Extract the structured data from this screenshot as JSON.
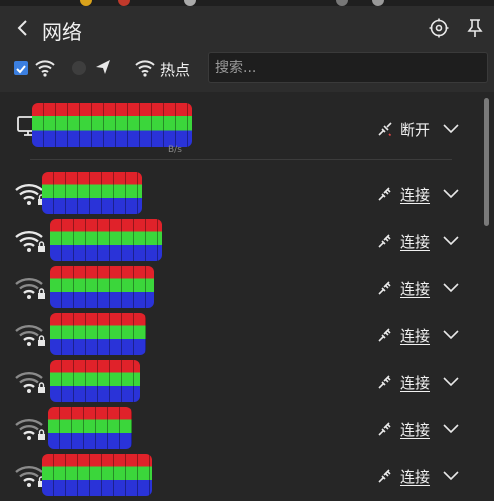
{
  "header": {
    "title": "网络",
    "back_icon": "back-arrow-icon",
    "settings_icon": "settings-icon",
    "pin_icon": "pin-icon"
  },
  "toolbar": {
    "wifi_enabled": true,
    "hotspot_label": "热点",
    "search_placeholder": "搜索..."
  },
  "connected": {
    "speed_suffix": "B/s",
    "action_label": "断开"
  },
  "networks": [
    {
      "action_label": "连接",
      "signal": "full"
    },
    {
      "action_label": "连接",
      "signal": "full"
    },
    {
      "action_label": "连接",
      "signal": "medium"
    },
    {
      "action_label": "连接",
      "signal": "medium"
    },
    {
      "action_label": "连接",
      "signal": "medium"
    },
    {
      "action_label": "连接",
      "signal": "medium"
    },
    {
      "action_label": "连接",
      "signal": "medium"
    }
  ],
  "colors": {
    "accent": "#3b7fe0",
    "background": "#2d2d2d",
    "list_background": "#262626"
  }
}
